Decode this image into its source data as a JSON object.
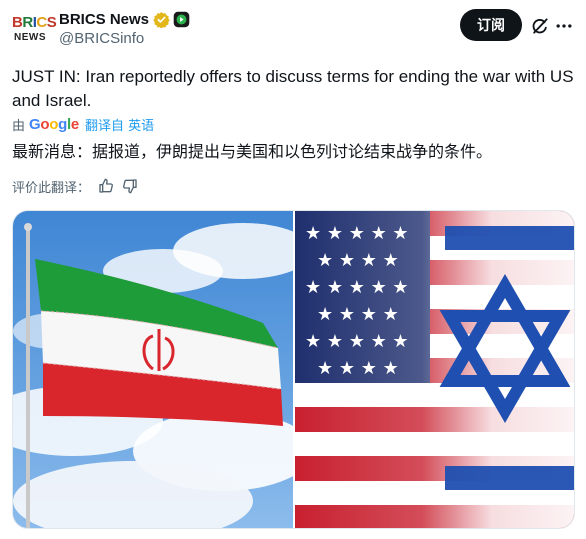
{
  "account": {
    "display_name": "BRICS News",
    "handle": "@BRICSinfo",
    "logo_top": "BRICS",
    "logo_bottom": "NEWS"
  },
  "actions": {
    "subscribe_label": "订阅"
  },
  "tweet": {
    "text": "JUST IN: Iran reportedly offers to discuss terms for ending the war with US and Israel.",
    "translated_text": "最新消息：据报道，伊朗提出与美国和以色列讨论结束战争的条件。"
  },
  "translation": {
    "prefix": "由",
    "provider": "Google",
    "link_text": "翻译自 英语"
  },
  "rating": {
    "prompt": "评价此翻译："
  },
  "icons": {
    "verified": "verified-badge-icon",
    "affiliate": "affiliate-badge-icon",
    "grok": "grok-icon",
    "more": "more-icon",
    "thumbs_up": "thumbs-up-icon",
    "thumbs_down": "thumbs-down-icon"
  },
  "colors": {
    "text_primary": "#0f1419",
    "text_secondary": "#536471",
    "link": "#1d9bf0",
    "verified_gold": "#e2b719",
    "button_dark": "#0f1419"
  },
  "media": {
    "left_image": "iran-flag-photo",
    "right_image": "us-israel-flag-photo"
  }
}
